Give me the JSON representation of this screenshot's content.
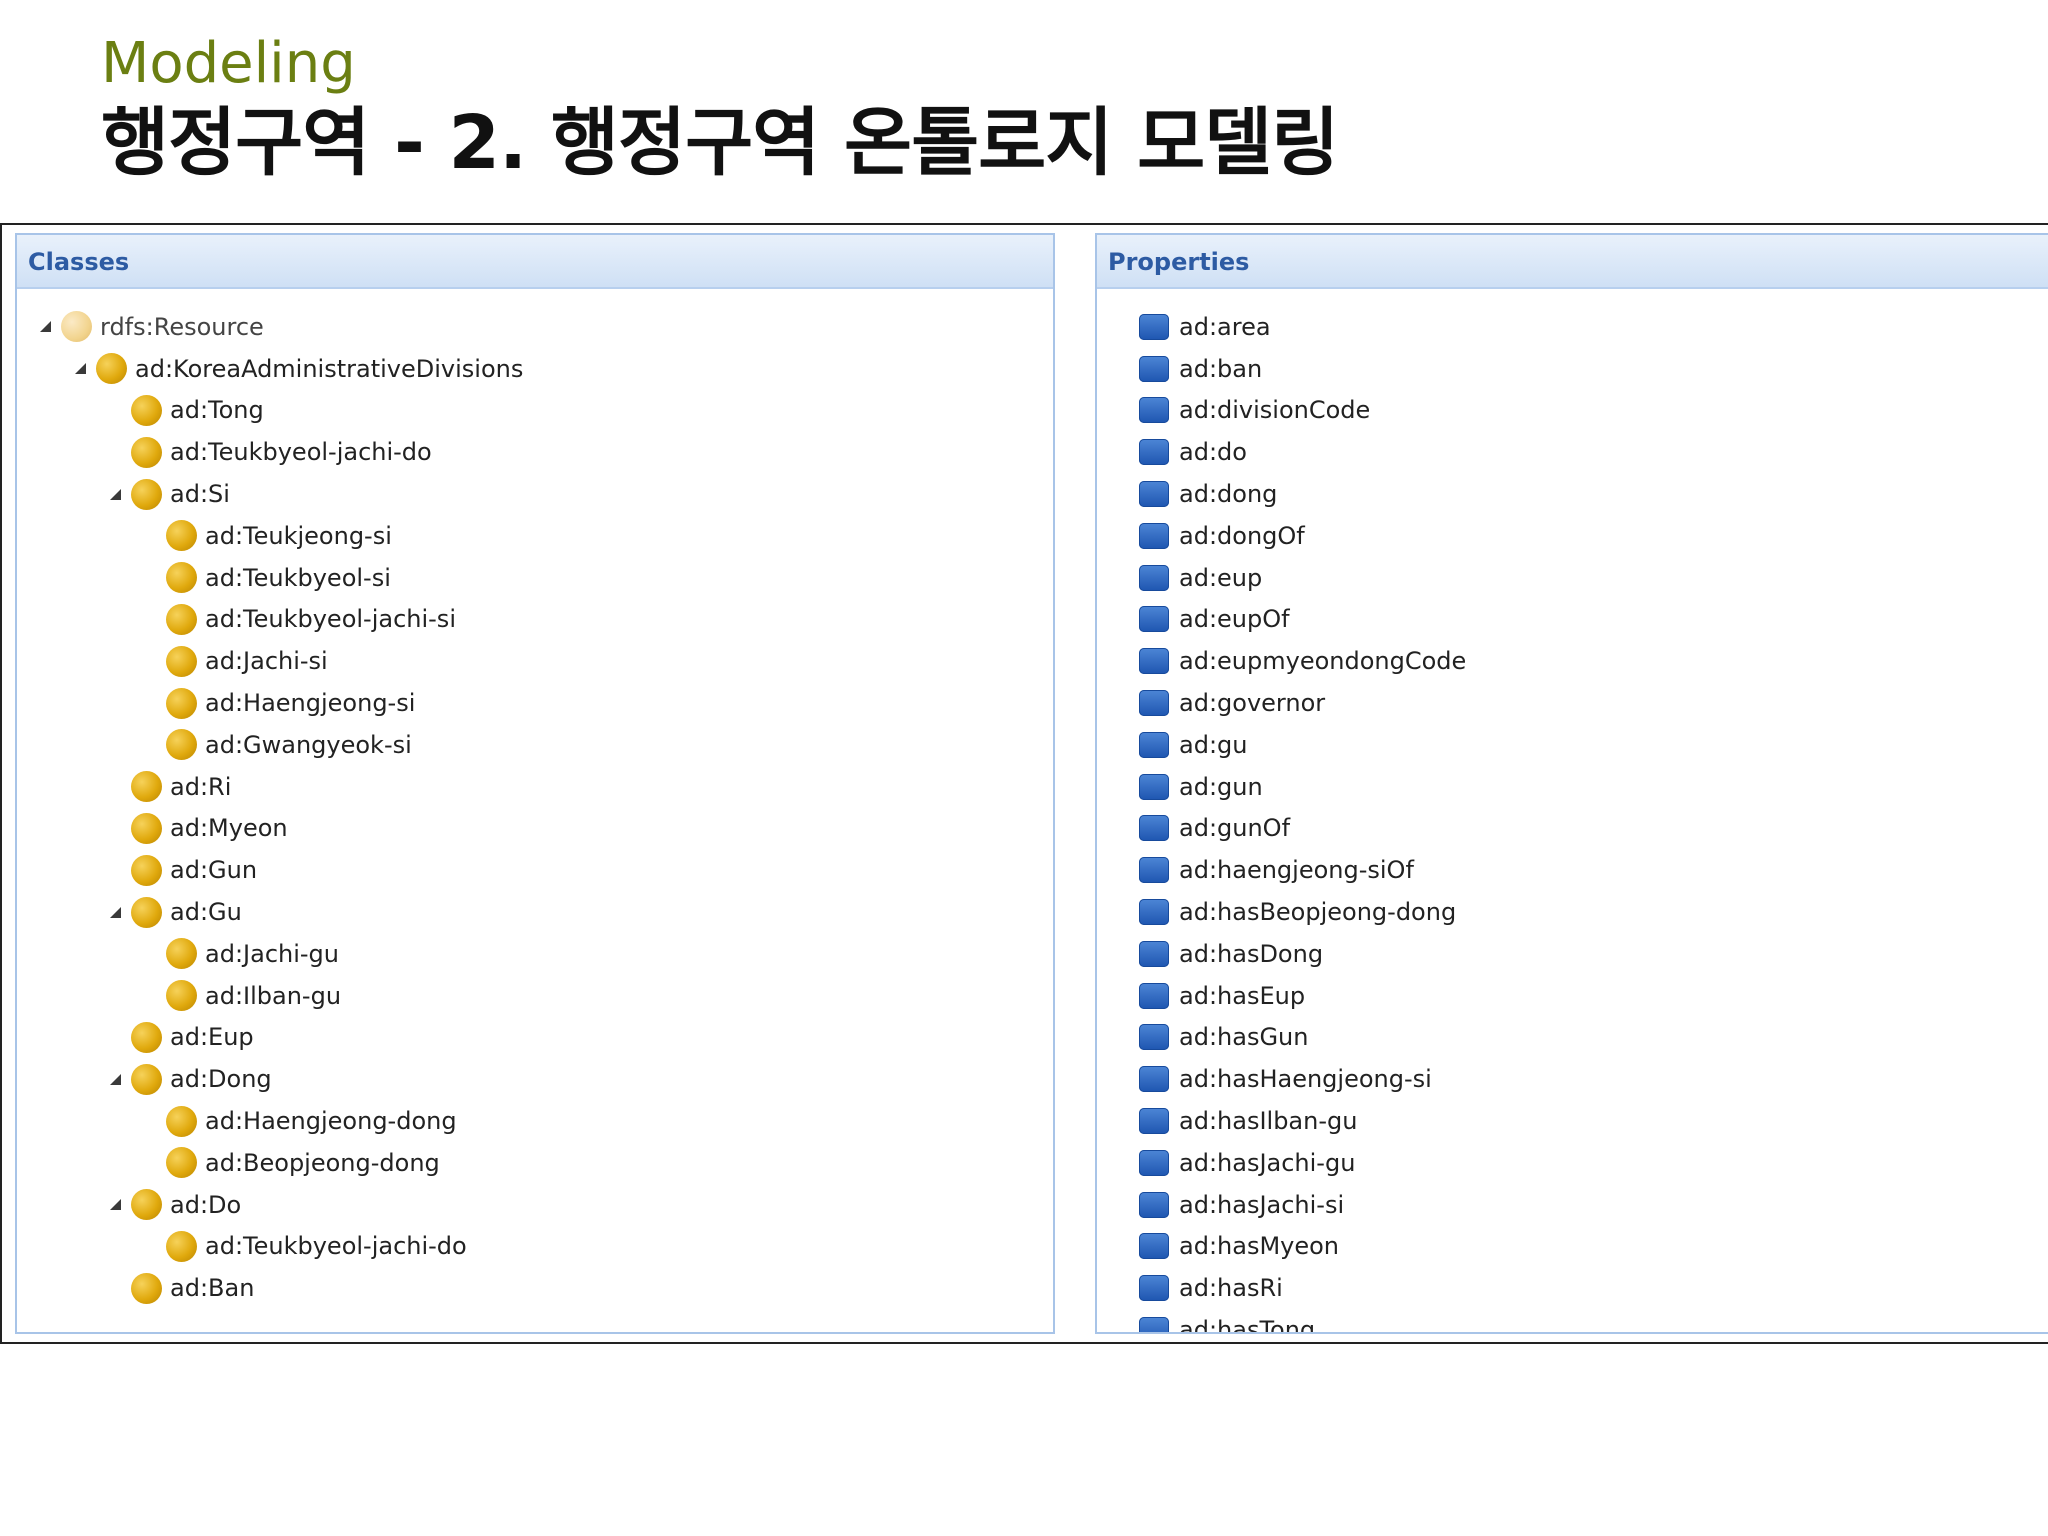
{
  "slide": {
    "subtitle": "Modeling",
    "title": "행정구역 - 2. 행정구역 온톨로지 모델링"
  },
  "classes_panel": {
    "header": "Classes",
    "items": [
      {
        "label": "rdfs:Resource",
        "level": 0,
        "expanded": true,
        "icon": "class-root-icon"
      },
      {
        "label": "ad:KoreaAdministrativeDivisions",
        "level": 1,
        "expanded": true,
        "icon": "class-icon"
      },
      {
        "label": "ad:Tong",
        "level": 2,
        "expanded": false,
        "icon": "class-icon"
      },
      {
        "label": "ad:Teukbyeol-jachi-do",
        "level": 2,
        "expanded": false,
        "icon": "class-icon"
      },
      {
        "label": "ad:Si",
        "level": 2,
        "expanded": true,
        "icon": "class-icon"
      },
      {
        "label": "ad:Teukjeong-si",
        "level": 3,
        "expanded": false,
        "icon": "class-icon"
      },
      {
        "label": "ad:Teukbyeol-si",
        "level": 3,
        "expanded": false,
        "icon": "class-icon"
      },
      {
        "label": "ad:Teukbyeol-jachi-si",
        "level": 3,
        "expanded": false,
        "icon": "class-icon"
      },
      {
        "label": "ad:Jachi-si",
        "level": 3,
        "expanded": false,
        "icon": "class-icon"
      },
      {
        "label": "ad:Haengjeong-si",
        "level": 3,
        "expanded": false,
        "icon": "class-icon"
      },
      {
        "label": "ad:Gwangyeok-si",
        "level": 3,
        "expanded": false,
        "icon": "class-icon"
      },
      {
        "label": "ad:Ri",
        "level": 2,
        "expanded": false,
        "icon": "class-icon"
      },
      {
        "label": "ad:Myeon",
        "level": 2,
        "expanded": false,
        "icon": "class-icon"
      },
      {
        "label": "ad:Gun",
        "level": 2,
        "expanded": false,
        "icon": "class-icon"
      },
      {
        "label": "ad:Gu",
        "level": 2,
        "expanded": true,
        "icon": "class-icon"
      },
      {
        "label": "ad:Jachi-gu",
        "level": 3,
        "expanded": false,
        "icon": "class-icon"
      },
      {
        "label": "ad:Ilban-gu",
        "level": 3,
        "expanded": false,
        "icon": "class-icon"
      },
      {
        "label": "ad:Eup",
        "level": 2,
        "expanded": false,
        "icon": "class-icon"
      },
      {
        "label": "ad:Dong",
        "level": 2,
        "expanded": true,
        "icon": "class-icon"
      },
      {
        "label": "ad:Haengjeong-dong",
        "level": 3,
        "expanded": false,
        "icon": "class-icon"
      },
      {
        "label": "ad:Beopjeong-dong",
        "level": 3,
        "expanded": false,
        "icon": "class-icon"
      },
      {
        "label": "ad:Do",
        "level": 2,
        "expanded": true,
        "icon": "class-icon"
      },
      {
        "label": "ad:Teukbyeol-jachi-do",
        "level": 3,
        "expanded": false,
        "icon": "class-icon"
      },
      {
        "label": "ad:Ban",
        "level": 2,
        "expanded": false,
        "icon": "class-icon"
      }
    ]
  },
  "properties_panel": {
    "header": "Properties",
    "items": [
      "ad:area",
      "ad:ban",
      "ad:divisionCode",
      "ad:do",
      "ad:dong",
      "ad:dongOf",
      "ad:eup",
      "ad:eupOf",
      "ad:eupmyeondongCode",
      "ad:governor",
      "ad:gu",
      "ad:gun",
      "ad:gunOf",
      "ad:haengjeong-siOf",
      "ad:hasBeopjeong-dong",
      "ad:hasDong",
      "ad:hasEup",
      "ad:hasGun",
      "ad:hasHaengjeong-si",
      "ad:hasIlban-gu",
      "ad:hasJachi-gu",
      "ad:hasJachi-si",
      "ad:hasMyeon",
      "ad:hasRi",
      "ad:hasTong"
    ]
  },
  "colors": {
    "subtitle": "#6b7f12",
    "panel_header_text": "#2d5ba3",
    "class_icon": "#e0a90d",
    "property_icon": "#1e55b0"
  }
}
